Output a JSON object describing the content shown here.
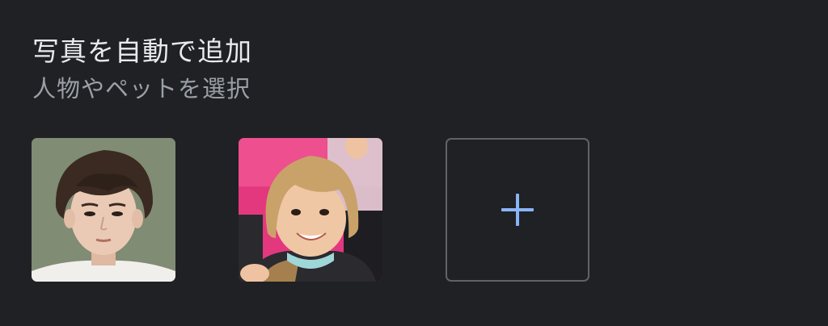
{
  "section": {
    "title": "写真を自動で追加",
    "subtitle": "人物やペットを選択"
  },
  "faces": [
    {
      "name": "face-1",
      "description_colors": {
        "background": "#7e8a73",
        "hair": "#3b2b22",
        "skin": "#e9c9b4"
      }
    },
    {
      "name": "face-2",
      "description_colors": {
        "background": "#e9357d",
        "hair": "#caa46b",
        "skin": "#f0c9a8"
      }
    }
  ],
  "add_button": {
    "icon": "plus-icon",
    "accent_color": "#8ab4f8"
  }
}
